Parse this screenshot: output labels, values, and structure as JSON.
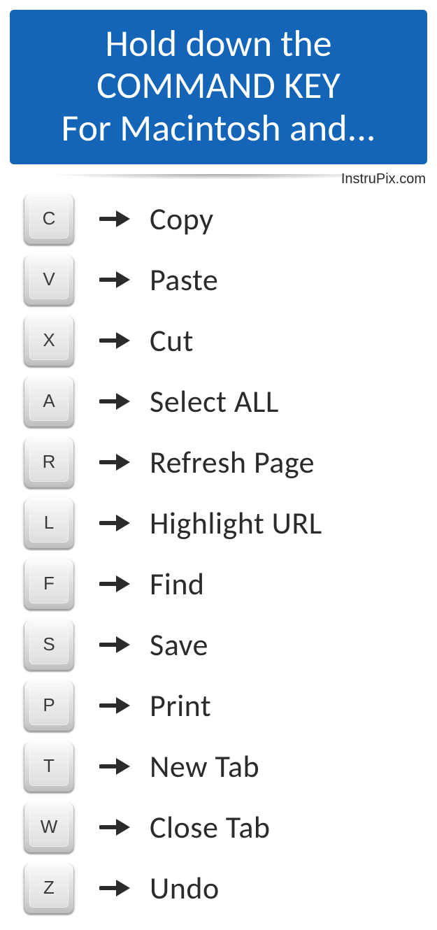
{
  "header": {
    "line1": "Hold down the",
    "line2": "COMMAND KEY",
    "line3": "For Macintosh and..."
  },
  "attribution": "InstruPix.com",
  "shortcuts": [
    {
      "key": "C",
      "action": "Copy"
    },
    {
      "key": "V",
      "action": "Paste"
    },
    {
      "key": "X",
      "action": "Cut"
    },
    {
      "key": "A",
      "action": "Select  ALL"
    },
    {
      "key": "R",
      "action": "Refresh Page"
    },
    {
      "key": "L",
      "action": "Highlight URL"
    },
    {
      "key": "F",
      "action": "Find"
    },
    {
      "key": "S",
      "action": "Save"
    },
    {
      "key": "P",
      "action": "Print"
    },
    {
      "key": "T",
      "action": "New Tab"
    },
    {
      "key": "W",
      "action": "Close Tab"
    },
    {
      "key": "Z",
      "action": "Undo"
    }
  ]
}
